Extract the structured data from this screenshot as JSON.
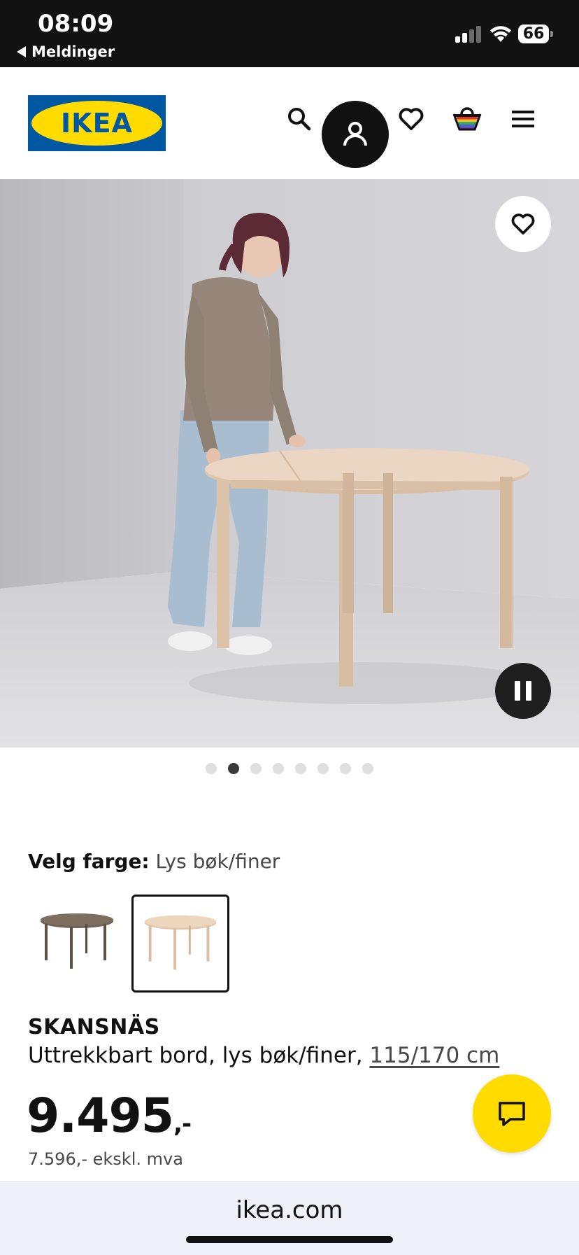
{
  "status_bar": {
    "time": "08:09",
    "back_label": "Meldinger",
    "battery": "66"
  },
  "header": {
    "logo_text": "IKEA",
    "icons": [
      "search-icon",
      "account-icon",
      "heart-icon",
      "cart-icon",
      "menu-icon"
    ]
  },
  "gallery": {
    "dot_count": 8,
    "active_index": 1
  },
  "color_select": {
    "label": "Velg farge:",
    "value": "Lys bøk/finer",
    "options": [
      "dark-brown-table",
      "light-beech-table"
    ],
    "selected_index": 1
  },
  "product": {
    "name": "SKANSNÄS",
    "description": "Uttrekkbart bord, lys bøk/finer,",
    "size_link": "115/170 cm",
    "price": "9.495",
    "price_suffix": ",-",
    "price_ex_vat": "7.596,- ekskl. mva"
  },
  "browser": {
    "url": "ikea.com"
  },
  "colors": {
    "ikea_blue": "#0058a3",
    "ikea_yellow": "#ffdb00",
    "status_bg": "#121212"
  }
}
